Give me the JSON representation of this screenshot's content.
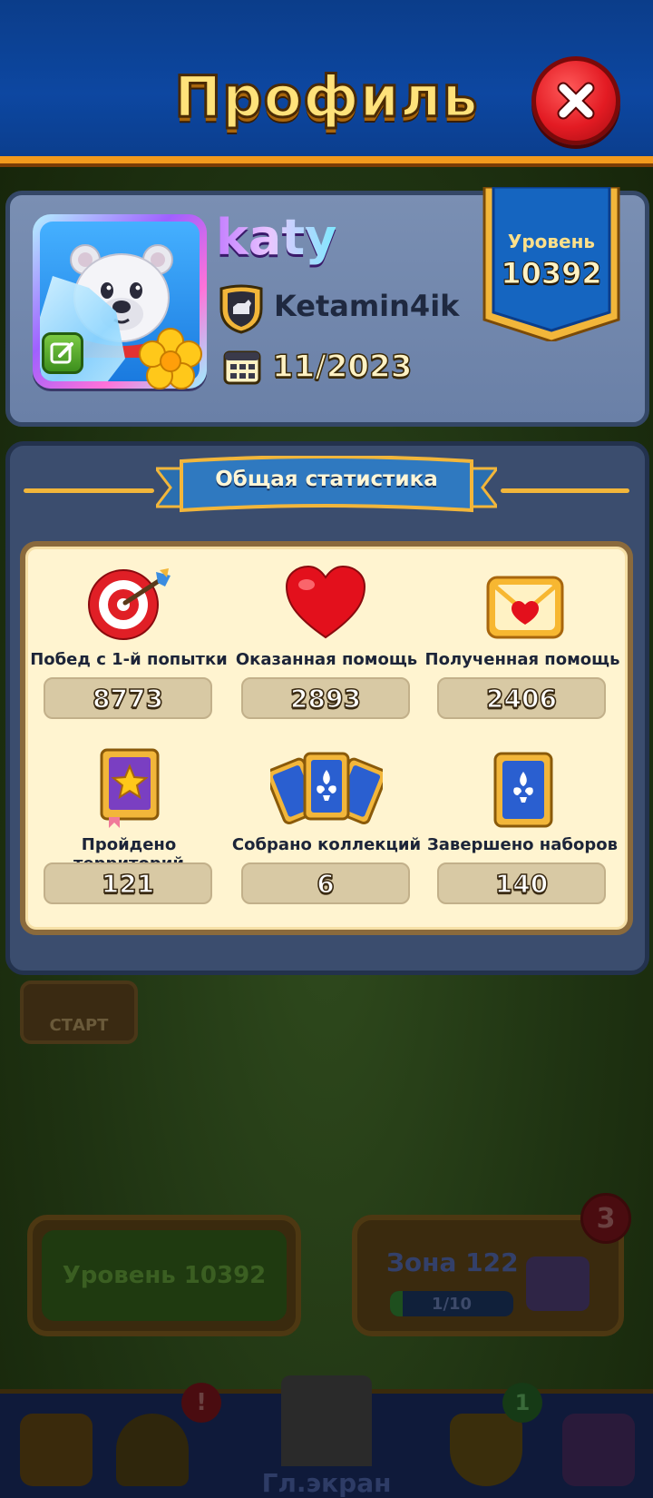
{
  "header": {
    "title": "Профиль"
  },
  "profile": {
    "username": "katy",
    "team": "Ketamin4ik",
    "joined": "11/2023",
    "level_label": "Уровень",
    "level_value": "10392"
  },
  "stats": {
    "section_title": "Общая статистика",
    "items": [
      {
        "icon": "target-icon",
        "label": "Побед с 1-й попытки",
        "value": "8773"
      },
      {
        "icon": "heart-icon",
        "label": "Оказанная помощь",
        "value": "2893"
      },
      {
        "icon": "envelope-heart-icon",
        "label": "Полученная помощь",
        "value": "2406"
      },
      {
        "icon": "star-book-icon",
        "label": "Пройдено территорий",
        "value": "121"
      },
      {
        "icon": "card-collection-icon",
        "label": "Собрано коллекций",
        "value": "6"
      },
      {
        "icon": "card-set-icon",
        "label": "Завершено наборов",
        "value": "140"
      }
    ]
  },
  "background": {
    "start_label": "СТАРТ",
    "level_button": "Уровень 10392",
    "zone_title": "Зона 122",
    "zone_progress": "1/10",
    "zone_progress_fraction": 0.1,
    "zone_badge": "3",
    "nav_label": "Гл.экран",
    "nav_badge_alert": "!",
    "nav_badge_team": "1"
  },
  "colors": {
    "header_blue": "#0d47a1",
    "accent_orange": "#f39a1d",
    "title_gold": "#ffe27a",
    "close_red": "#e31b23",
    "panel_slate": "#3b4d6e",
    "stats_cream": "#fff4d0"
  }
}
